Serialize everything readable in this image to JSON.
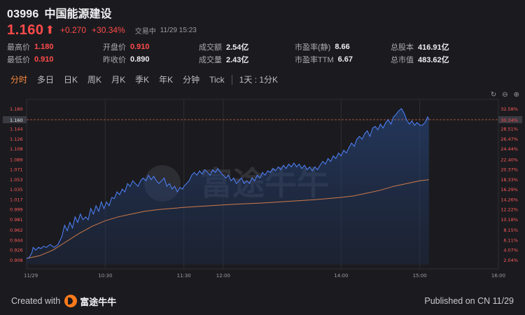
{
  "stock": {
    "code": "03996",
    "name": "中国能源建设",
    "price": "1.160",
    "arrow": "⬆",
    "change": "+0.270",
    "change_pct": "+30.34%",
    "status": "交易中",
    "time": "11/29 15:23"
  },
  "stats": {
    "row1": [
      {
        "label": "最高价",
        "value": "1.180",
        "tone": "up"
      },
      {
        "label": "开盘价",
        "value": "0.910",
        "tone": "up"
      },
      {
        "label": "成交额",
        "value": "2.54亿",
        "tone": "neutral"
      },
      {
        "label": "市盈率(静)",
        "value": "8.66",
        "tone": "neutral"
      },
      {
        "label": "总股本",
        "value": "416.91亿",
        "tone": "neutral"
      }
    ],
    "row2": [
      {
        "label": "最低价",
        "value": "0.910",
        "tone": "up"
      },
      {
        "label": "昨收价",
        "value": "0.890",
        "tone": "neutral"
      },
      {
        "label": "成交量",
        "value": "2.43亿",
        "tone": "neutral"
      },
      {
        "label": "市盈率TTM",
        "value": "6.67",
        "tone": "neutral"
      },
      {
        "label": "总市值",
        "value": "483.62亿",
        "tone": "neutral"
      }
    ]
  },
  "tabs": [
    "分时",
    "多日",
    "日K",
    "周K",
    "月K",
    "季K",
    "年K",
    "分钟",
    "Tick"
  ],
  "active_tab": 0,
  "period_selector": "1天 : 1分K",
  "footer": {
    "created_with": "Created with",
    "brand": "富途牛牛",
    "published": "Published on CN 11/29"
  },
  "watermark": "富途牛牛",
  "colors": {
    "price_line": "#4f83ff",
    "avg_line": "#d07a4a",
    "up": "#ff4a4a",
    "axis_text_left": "#ff5a5a",
    "axis_text_right": "#ff5a5a",
    "grid": "#2e2e34",
    "ref_line": "#d4664a",
    "accent": "#ff8a3c"
  },
  "chart_data": {
    "type": "line",
    "prev_close": 0.89,
    "ylim": [
      0.899,
      1.189
    ],
    "y_ticks_left": [
      "1.180",
      "1.162",
      "1.144",
      "1.126",
      "1.108",
      "1.089",
      "1.071",
      "1.053",
      "1.035",
      "1.017",
      "0.999",
      "0.981",
      "0.962",
      "0.944",
      "0.926",
      "0.908"
    ],
    "y_ticks_right": [
      "32.58%",
      "30.54%",
      "28.51%",
      "26.47%",
      "24.44%",
      "22.40%",
      "20.37%",
      "18.33%",
      "16.29%",
      "14.26%",
      "12.22%",
      "10.18%",
      "8.15%",
      "6.11%",
      "4.07%",
      "2.04%"
    ],
    "current_price_label": "1.160",
    "current_pct_label": "30.34%",
    "x_ticks": [
      "11/29",
      "10:30",
      "11:30",
      "12:00",
      "14:00",
      "15:00",
      "16:00"
    ],
    "x_tick_minutes": [
      0,
      60,
      120,
      150,
      240,
      300,
      360
    ],
    "xlim_minutes": [
      0,
      360
    ],
    "series": [
      {
        "type": "price",
        "points": [
          [
            0,
            0.91
          ],
          [
            2,
            0.912
          ],
          [
            4,
            0.92
          ],
          [
            5,
            0.93
          ],
          [
            7,
            0.925
          ],
          [
            9,
            0.93
          ],
          [
            11,
            0.928
          ],
          [
            13,
            0.932
          ],
          [
            15,
            0.93
          ],
          [
            18,
            0.935
          ],
          [
            21,
            0.93
          ],
          [
            24,
            0.935
          ],
          [
            27,
            0.95
          ],
          [
            29,
            0.97
          ],
          [
            31,
            0.96
          ],
          [
            33,
            0.975
          ],
          [
            35,
            0.965
          ],
          [
            37,
            0.985
          ],
          [
            39,
            0.975
          ],
          [
            41,
            0.99
          ],
          [
            43,
            0.98
          ],
          [
            45,
            0.985
          ],
          [
            47,
            0.98
          ],
          [
            49,
            1.0
          ],
          [
            51,
            0.99
          ],
          [
            53,
            1.005
          ],
          [
            55,
            0.995
          ],
          [
            57,
            1.012
          ],
          [
            59,
            1.0
          ],
          [
            61,
            1.012
          ],
          [
            63,
            1.005
          ],
          [
            65,
            1.02
          ],
          [
            67,
            1.018
          ],
          [
            69,
            1.03
          ],
          [
            71,
            1.025
          ],
          [
            73,
            1.035
          ],
          [
            75,
            1.03
          ],
          [
            77,
            1.045
          ],
          [
            79,
            1.04
          ],
          [
            81,
            1.05
          ],
          [
            83,
            1.045
          ],
          [
            85,
            1.04
          ],
          [
            87,
            1.05
          ],
          [
            89,
            1.055
          ],
          [
            91,
            1.05
          ],
          [
            93,
            1.06
          ],
          [
            95,
            1.052
          ],
          [
            97,
            1.058
          ],
          [
            99,
            1.05
          ],
          [
            101,
            1.045
          ],
          [
            103,
            1.05
          ],
          [
            105,
            1.055
          ],
          [
            107,
            1.04
          ],
          [
            109,
            1.045
          ],
          [
            111,
            1.035
          ],
          [
            113,
            1.04
          ],
          [
            115,
            1.03
          ],
          [
            117,
            1.038
          ],
          [
            119,
            1.035
          ],
          [
            120,
            1.04
          ],
          [
            122,
            1.045
          ],
          [
            124,
            1.05
          ],
          [
            126,
            1.06
          ],
          [
            128,
            1.065
          ],
          [
            130,
            1.06
          ],
          [
            132,
            1.068
          ],
          [
            134,
            1.062
          ],
          [
            136,
            1.07
          ],
          [
            138,
            1.065
          ],
          [
            140,
            1.06
          ],
          [
            142,
            1.07
          ],
          [
            144,
            1.065
          ],
          [
            146,
            1.072
          ],
          [
            148,
            1.065
          ],
          [
            150,
            1.06
          ],
          [
            152,
            1.055
          ],
          [
            154,
            1.06
          ],
          [
            156,
            1.05
          ],
          [
            158,
            1.055
          ],
          [
            160,
            1.045
          ],
          [
            162,
            1.05
          ],
          [
            164,
            1.055
          ],
          [
            166,
            1.045
          ],
          [
            168,
            1.05
          ],
          [
            170,
            1.045
          ],
          [
            172,
            1.055
          ],
          [
            174,
            1.05
          ],
          [
            176,
            1.06
          ],
          [
            178,
            1.055
          ],
          [
            180,
            1.065
          ],
          [
            182,
            1.06
          ],
          [
            184,
            1.068
          ],
          [
            186,
            1.065
          ],
          [
            188,
            1.072
          ],
          [
            190,
            1.068
          ],
          [
            192,
            1.075
          ],
          [
            194,
            1.07
          ],
          [
            196,
            1.078
          ],
          [
            198,
            1.072
          ],
          [
            200,
            1.08
          ],
          [
            202,
            1.075
          ],
          [
            204,
            1.082
          ],
          [
            206,
            1.075
          ],
          [
            208,
            1.08
          ],
          [
            210,
            1.072
          ],
          [
            212,
            1.078
          ],
          [
            214,
            1.07
          ],
          [
            216,
            1.075
          ],
          [
            218,
            1.068
          ],
          [
            220,
            1.075
          ],
          [
            222,
            1.07
          ],
          [
            224,
            1.078
          ],
          [
            226,
            1.085
          ],
          [
            228,
            1.08
          ],
          [
            230,
            1.09
          ],
          [
            232,
            1.085
          ],
          [
            234,
            1.095
          ],
          [
            236,
            1.09
          ],
          [
            238,
            1.1
          ],
          [
            240,
            1.095
          ],
          [
            242,
            1.105
          ],
          [
            244,
            1.1
          ],
          [
            246,
            1.11
          ],
          [
            248,
            1.118
          ],
          [
            250,
            1.112
          ],
          [
            252,
            1.125
          ],
          [
            254,
            1.13
          ],
          [
            256,
            1.125
          ],
          [
            258,
            1.135
          ],
          [
            260,
            1.14
          ],
          [
            262,
            1.13
          ],
          [
            264,
            1.145
          ],
          [
            266,
            1.148
          ],
          [
            268,
            1.142
          ],
          [
            270,
            1.152
          ],
          [
            272,
            1.145
          ],
          [
            274,
            1.155
          ],
          [
            276,
            1.16
          ],
          [
            278,
            1.152
          ],
          [
            280,
            1.165
          ],
          [
            282,
            1.17
          ],
          [
            284,
            1.176
          ],
          [
            286,
            1.18
          ],
          [
            288,
            1.172
          ],
          [
            290,
            1.16
          ],
          [
            292,
            1.152
          ],
          [
            294,
            1.158
          ],
          [
            296,
            1.15
          ],
          [
            298,
            1.155
          ],
          [
            300,
            1.15
          ],
          [
            302,
            1.15
          ],
          [
            304,
            1.155
          ],
          [
            306,
            1.165
          ],
          [
            307,
            1.16
          ]
        ]
      },
      {
        "type": "average",
        "points": [
          [
            0,
            0.91
          ],
          [
            10,
            0.915
          ],
          [
            20,
            0.925
          ],
          [
            30,
            0.94
          ],
          [
            40,
            0.955
          ],
          [
            50,
            0.968
          ],
          [
            60,
            0.978
          ],
          [
            70,
            0.985
          ],
          [
            80,
            0.99
          ],
          [
            90,
            0.995
          ],
          [
            100,
            0.998
          ],
          [
            110,
            1.0
          ],
          [
            120,
            1.002
          ],
          [
            140,
            1.005
          ],
          [
            160,
            1.008
          ],
          [
            180,
            1.01
          ],
          [
            200,
            1.013
          ],
          [
            220,
            1.016
          ],
          [
            240,
            1.02
          ],
          [
            250,
            1.023
          ],
          [
            260,
            1.028
          ],
          [
            270,
            1.033
          ],
          [
            280,
            1.04
          ],
          [
            290,
            1.045
          ],
          [
            300,
            1.05
          ],
          [
            307,
            1.052
          ]
        ]
      }
    ]
  }
}
